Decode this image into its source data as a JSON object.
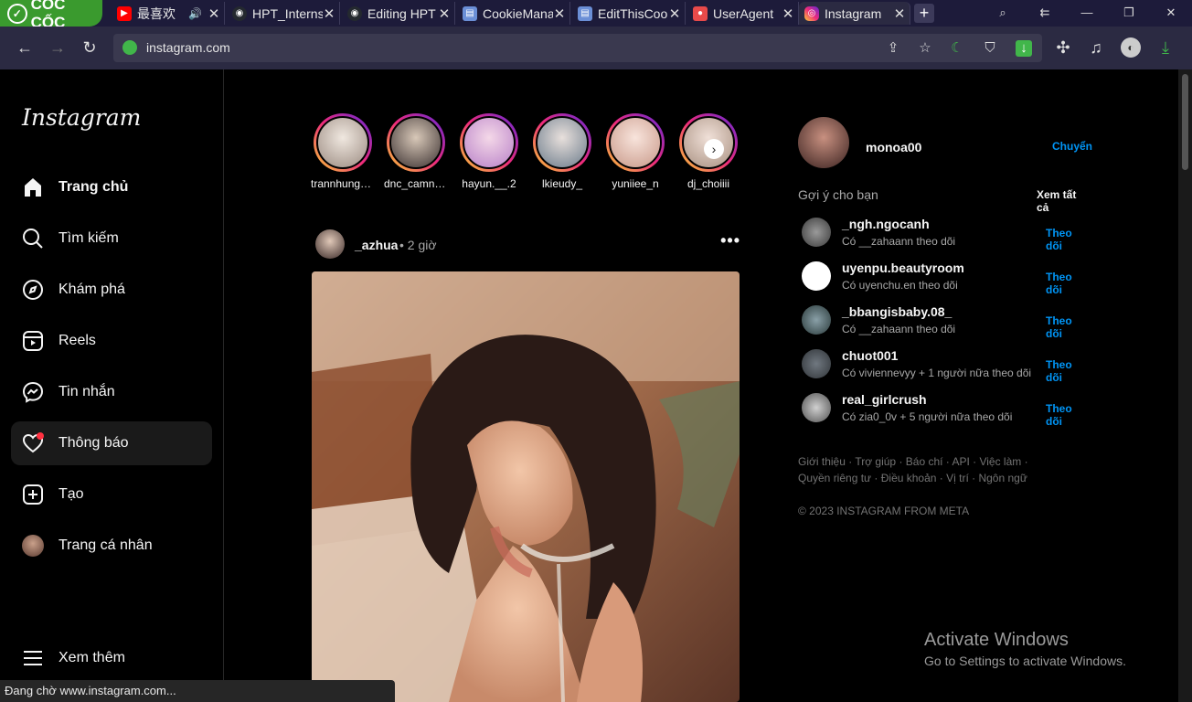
{
  "browser": {
    "brand": "CỐC CỐC",
    "tabs": [
      {
        "title": "最喜欢",
        "fav": "youtube-icon",
        "color": "#ff0000",
        "audio": true
      },
      {
        "title": "HPT_Internship",
        "fav": "github-icon",
        "color": "#24292f"
      },
      {
        "title": "Editing HPT",
        "fav": "github-icon",
        "color": "#24292f"
      },
      {
        "title": "CookieManager",
        "fav": "extension-icon",
        "color": "#6b8fd6"
      },
      {
        "title": "EditThisCookie",
        "fav": "extension-icon",
        "color": "#6b8fd6"
      },
      {
        "title": "UserAgent",
        "fav": "extension-icon",
        "color": "#e84a4a"
      },
      {
        "title": "Instagram",
        "fav": "instagram-icon",
        "color": "#d6249f"
      }
    ],
    "new_tab": "+",
    "url": "instagram.com"
  },
  "sidebar": {
    "logo": "Instagram",
    "items": [
      {
        "label": "Trang chủ",
        "icon": "home-icon",
        "bold": true
      },
      {
        "label": "Tìm kiếm",
        "icon": "search-icon"
      },
      {
        "label": "Khám phá",
        "icon": "compass-icon"
      },
      {
        "label": "Reels",
        "icon": "reels-icon"
      },
      {
        "label": "Tin nhắn",
        "icon": "messenger-icon"
      },
      {
        "label": "Thông báo",
        "icon": "heart-icon",
        "selected": true
      },
      {
        "label": "Tạo",
        "icon": "plus-square-icon"
      },
      {
        "label": "Trang cá nhân",
        "icon": "avatar"
      }
    ],
    "more": "Xem thêm"
  },
  "stories": [
    {
      "name": "trannhunguyen"
    },
    {
      "name": "dnc_camnhung"
    },
    {
      "name": "hayun.__.2"
    },
    {
      "name": "lkieudy_"
    },
    {
      "name": "yuniiee_n"
    },
    {
      "name": "dj_choiiii"
    }
  ],
  "post": {
    "username": "_azhua",
    "time": "• 2 giờ",
    "more": "•••"
  },
  "right": {
    "me": {
      "username": "monoa00",
      "switch": "Chuyển"
    },
    "suggestions_title": "Gợi ý cho bạn",
    "see_all": "Xem tất cả",
    "suggestions": [
      {
        "username": "_ngh.ngocanh",
        "sub": "Có __zahaann theo dõi",
        "follow": "Theo dõi"
      },
      {
        "username": "uyenpu.beautyroom",
        "sub": "Có uyenchu.en theo dõi",
        "follow": "Theo dõi"
      },
      {
        "username": "_bbangisbaby.08_",
        "sub": "Có __zahaann theo dõi",
        "follow": "Theo dõi"
      },
      {
        "username": "chuot001",
        "sub": "Có viviennevyy + 1 người nữa theo dõi",
        "follow": "Theo dõi"
      },
      {
        "username": "real_girlcrush",
        "sub": "Có zia0_0v + 5 người nữa theo dõi",
        "follow": "Theo dõi"
      }
    ],
    "footer_links": "Giới thiệu · Trợ giúp · Báo chí · API · Việc làm · Quyền riêng tư · Điều khoản · Vị trí · Ngôn ngữ",
    "copyright": "© 2023 INSTAGRAM FROM META"
  },
  "watermark": {
    "line1": "Activate Windows",
    "line2": "Go to Settings to activate Windows."
  },
  "status_bar": "Đang chờ www.instagram.com..."
}
